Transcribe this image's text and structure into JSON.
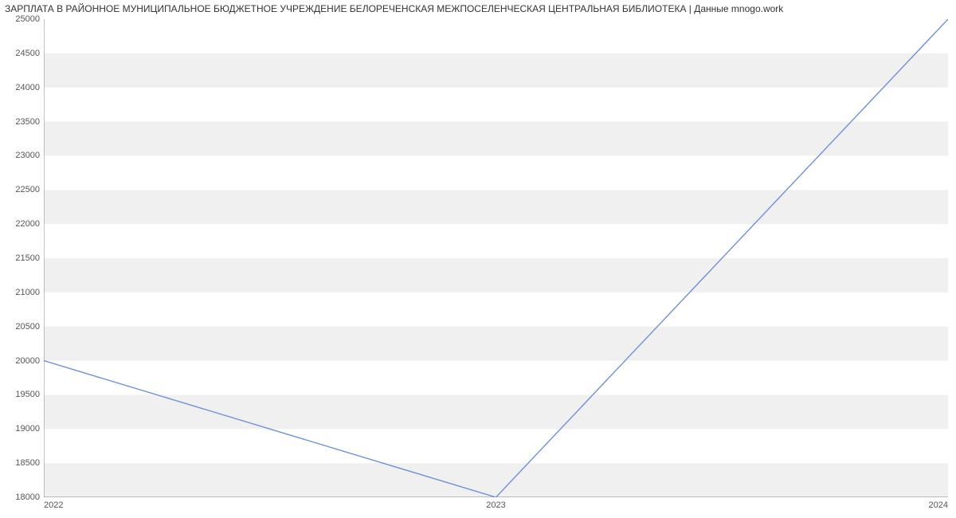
{
  "chart_data": {
    "type": "line",
    "title": "ЗАРПЛАТА В РАЙОННОЕ МУНИЦИПАЛЬНОЕ БЮДЖЕТНОЕ УЧРЕЖДЕНИЕ БЕЛОРЕЧЕНСКАЯ МЕЖПОСЕЛЕНЧЕСКАЯ ЦЕНТРАЛЬНАЯ БИБЛИОТЕКА | Данные mnogo.work",
    "x": [
      2022,
      2023,
      2024
    ],
    "values": [
      20000,
      18000,
      25000
    ],
    "xlabel": "",
    "ylabel": "",
    "ylim": [
      18000,
      25000
    ],
    "xlim": [
      2022,
      2024
    ],
    "y_ticks": [
      18000,
      18500,
      19000,
      19500,
      20000,
      20500,
      21000,
      21500,
      22000,
      22500,
      23000,
      23500,
      24000,
      24500,
      25000
    ],
    "x_ticks": [
      2022,
      2023,
      2024
    ],
    "series_color": "#6f8fd8"
  }
}
